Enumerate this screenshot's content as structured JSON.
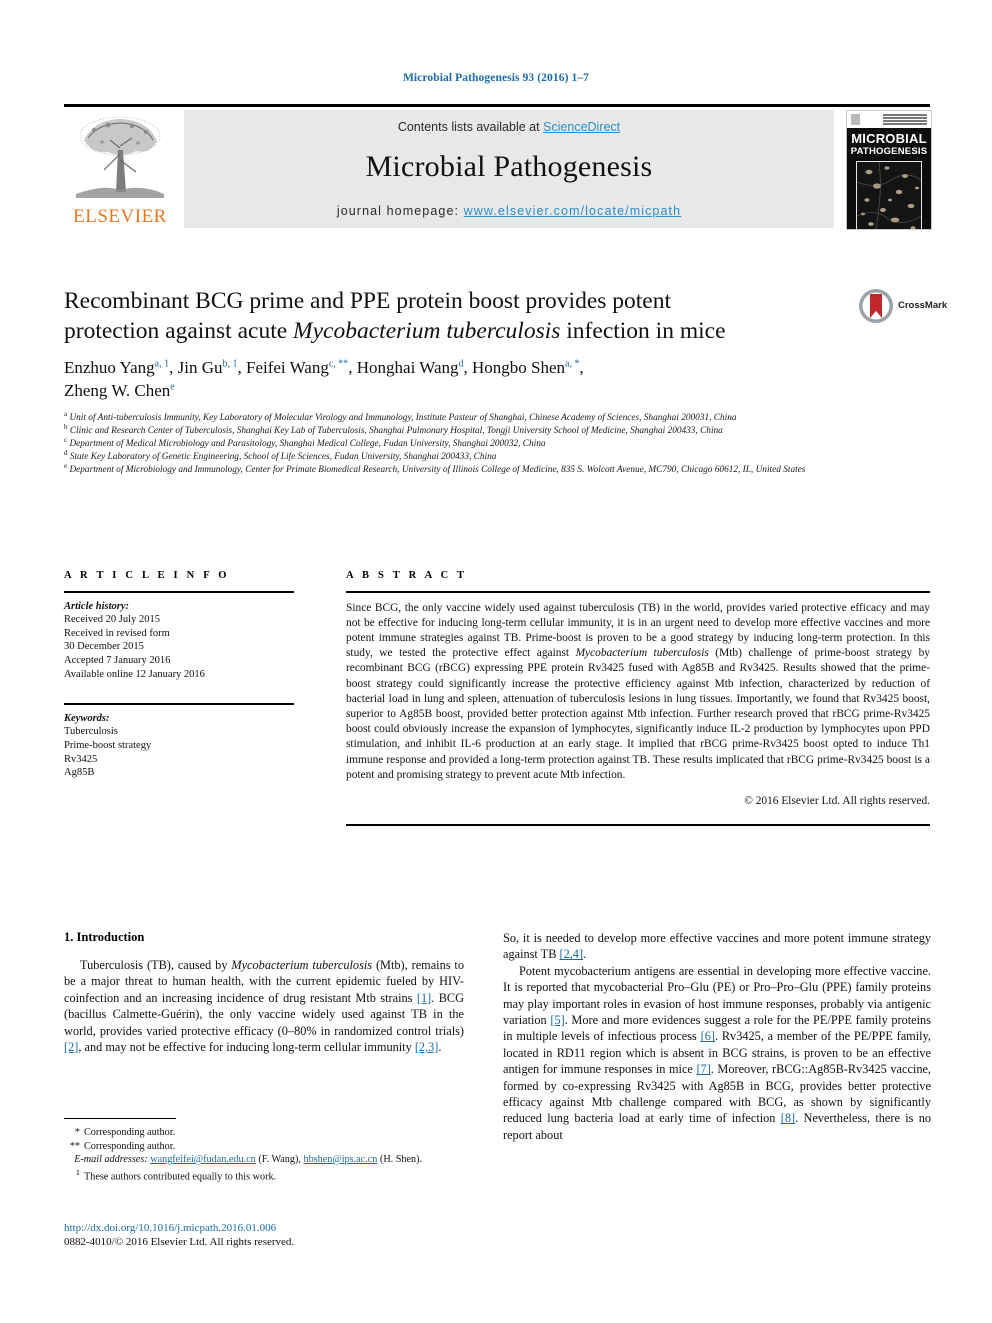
{
  "running_head": "Microbial Pathogenesis 93 (2016) 1–7",
  "masthead": {
    "contents_prefix": "Contents lists available at ",
    "sciencedirect": "ScienceDirect",
    "journal_name": "Microbial Pathogenesis",
    "homepage_label": "journal homepage: ",
    "homepage_url": "www.elsevier.com/locate/micpath",
    "elsevier_wordmark": "ELSEVIER",
    "cover_title_line1": "MICROBIAL",
    "cover_title_line2": "PATHOGENESIS",
    "link_color": "#2a8fd0",
    "elsevier_orange": "#E87722",
    "band_bg": "#e8e8e8"
  },
  "crossmark": {
    "label": "CrossMark"
  },
  "title": {
    "line1": "Recombinant BCG prime and PPE protein boost provides potent",
    "line2_a": "protection against acute ",
    "line2_italic": "Mycobacterium tuberculosis",
    "line2_b": " infection in mice"
  },
  "authors": {
    "list": [
      {
        "name": "Enzhuo Yang",
        "sup": "a, 1"
      },
      {
        "name": "Jin Gu",
        "sup": "b, 1"
      },
      {
        "name": "Feifei Wang",
        "sup": "c, **"
      },
      {
        "name": "Honghai Wang",
        "sup": "d"
      },
      {
        "name": "Hongbo Shen",
        "sup": "a, *"
      },
      {
        "name": "Zheng W. Chen",
        "sup": "e"
      }
    ]
  },
  "affiliations": [
    {
      "mark": "a",
      "text": "Unit of Anti-tuberculosis Immunity, Key Laboratory of Molecular Virology and Immunology, Institute Pasteur of Shanghai, Chinese Academy of Sciences, Shanghai 200031, China"
    },
    {
      "mark": "b",
      "text": "Clinic and Research Center of Tuberculosis, Shanghai Key Lab of Tuberculosis, Shanghai Pulmonary Hospital, Tongji University School of Medicine, Shanghai 200433, China"
    },
    {
      "mark": "c",
      "text": "Department of Medical Microbiology and Parasitology, Shanghai Medical College, Fudan University, Shanghai 200032, China"
    },
    {
      "mark": "d",
      "text": "State Key Laboratory of Genetic Engineering, School of Life Sciences, Fudan University, Shanghai 200433, China"
    },
    {
      "mark": "e",
      "text": "Department of Microbiology and Immunology, Center for Primate Biomedical Research, University of Illinois College of Medicine, 835 S. Wolcott Avenue, MC790, Chicago 60612, IL, United States"
    }
  ],
  "article_info": {
    "heading": "A R T I C L E   I N F O",
    "history_label": "Article history:",
    "history": [
      "Received 20 July 2015",
      "Received in revised form",
      "30 December 2015",
      "Accepted 7 January 2016",
      "Available online 12 January 2016"
    ],
    "keywords_label": "Keywords:",
    "keywords": [
      "Tuberculosis",
      "Prime-boost strategy",
      "Rv3425",
      "Ag85B"
    ]
  },
  "abstract": {
    "heading": "A B S T R A C T",
    "part1": "Since BCG, the only vaccine widely used against tuberculosis (TB) in the world, provides varied protective efficacy and may not be effective for inducing long-term cellular immunity, it is in an urgent need to develop more effective vaccines and more potent immune strategies against TB. Prime-boost is proven to be a good strategy by inducing long-term protection. In this study, we tested the protective effect against ",
    "italic1": "Mycobacterium tuberculosis",
    "part2": " (Mtb) challenge of prime-boost strategy by recombinant BCG (rBCG) expressing PPE protein Rv3425 fused with Ag85B and Rv3425. Results showed that the prime-boost strategy could significantly increase the protective efficiency against Mtb infection, characterized by reduction of bacterial load in lung and spleen, attenuation of tuberculosis lesions in lung tissues. Importantly, we found that Rv3425 boost, superior to Ag85B boost, provided better protection against Mtb infection. Further research proved that rBCG prime-Rv3425 boost could obviously increase the expansion of lymphocytes, significantly induce IL-2 production by lymphocytes upon PPD stimulation, and inhibit IL-6 production at an early stage. It implied that rBCG prime-Rv3425 boost opted to induce Th1 immune response and provided a long-term protection against TB. These results implicated that rBCG prime-Rv3425 boost is a potent and promising strategy to prevent acute Mtb infection.",
    "copyright": "© 2016 Elsevier Ltd. All rights reserved."
  },
  "introduction": {
    "heading": "1. Introduction",
    "left_para_a": "Tuberculosis (TB), caused by ",
    "left_para_a_italic": "Mycobacterium tuberculosis",
    "left_para_b": " (Mtb), remains to be a major threat to human health, with the current epidemic fueled by HIV-coinfection and an increasing incidence of drug resistant Mtb strains ",
    "ref1": "[1]",
    "left_para_c": ". BCG (bacillus Calmette-Guérin), the only vaccine widely used against TB in the world, provides varied protective efficacy (0–80% in randomized control trials) ",
    "ref2": "[2]",
    "left_para_d": ", and may not be effective for inducing long-term cellular immunity ",
    "ref23": "[2,3]",
    "left_para_e": ".",
    "right_p1_a": "So, it is needed to develop more effective vaccines and more potent immune strategy against TB ",
    "ref24": "[2,4]",
    "right_p1_b": ".",
    "right_p2_a": "Potent mycobacterium antigens are essential in developing more effective vaccine. It is reported that mycobacterial Pro–Glu (PE) or Pro–Pro–Glu (PPE) family proteins may play important roles in evasion of host immune responses, probably via antigenic variation ",
    "ref5": "[5]",
    "right_p2_b": ". More and more evidences suggest a role for the PE/PPE family proteins in multiple levels of infectious process ",
    "ref6": "[6]",
    "right_p2_c": ". Rv3425, a member of the PE/PPE family, located in RD11 region which is absent in BCG strains, is proven to be an effective antigen for immune responses in mice ",
    "ref7": "[7]",
    "right_p2_d": ". Moreover, rBCG::Ag85B-Rv3425 vaccine, formed by co-expressing Rv3425 with Ag85B in BCG, provides better protective efficacy against Mtb challenge compared with BCG, as shown by significantly reduced lung bacteria load at early time of infection ",
    "ref8": "[8]",
    "right_p2_e": ". Nevertheless, there is no report about"
  },
  "footnotes": {
    "corresponding1": "Corresponding author.",
    "corresponding1_mark": "*",
    "corresponding2": "Corresponding author.",
    "corresponding2_mark": "**",
    "email_label": "E-mail addresses:",
    "email1": "wangfeifei@fudan.edu.cn",
    "email1_owner": "(F. Wang)",
    "email2": "hbshen@ips.ac.cn",
    "email2_owner": "(H. Shen).",
    "equal_mark": "1",
    "equal_contrib": "These authors contributed equally to this work."
  },
  "footer": {
    "doi": "http://dx.doi.org/10.1016/j.micpath.2016.01.006",
    "issn": "0882-4010/© 2016 Elsevier Ltd. All rights reserved."
  }
}
